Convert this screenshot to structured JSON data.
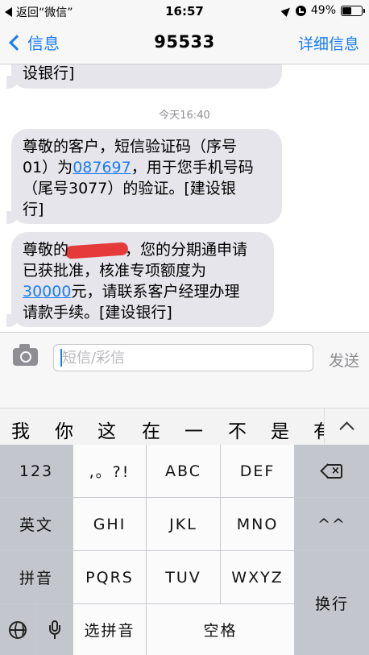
{
  "status_bar": {
    "back_app": "返回“微信”",
    "time": "16:57",
    "battery": "49%",
    "battery_level": 0.49
  },
  "nav": {
    "back_label": "信息",
    "title": "95533",
    "detail_label": "详细信息"
  },
  "messages": {
    "prev_tail": "设银行]",
    "time_separator": "今天16:40",
    "msg1": {
      "line1": "尊敬的客户，短信验证码（序号",
      "line2_prefix": "01）为",
      "code": "087697",
      "line2_suffix": "，用于您手机号码",
      "line3": "（尾号3077）的验证。[建设银",
      "line4": "行]"
    },
    "msg2": {
      "line1_prefix": "尊敬的",
      "line1_suffix": "，您的分期通申请",
      "line2": "已获批准，核准专项额度为",
      "amount": "30000",
      "line3_suffix": "元，请联系客户经理办理",
      "line4": "请款手续。[建设银行]"
    }
  },
  "input": {
    "placeholder": "短信/彩信",
    "send_label": "发送",
    "camera_icon": "camera-icon"
  },
  "candidates": [
    "我",
    "你",
    "这",
    "在",
    "一",
    "不",
    "是",
    "有"
  ],
  "keyboard": {
    "row1": [
      "123",
      ",。?!",
      "ABC",
      "DEF"
    ],
    "row2": [
      "英文",
      "GHI",
      "JKL",
      "MNO",
      "^^"
    ],
    "row3": [
      "拼音",
      "PQRS",
      "TUV",
      "WXYZ"
    ],
    "enter": "换行",
    "select_pinyin": "选拼音",
    "space": "空格"
  },
  "colors": {
    "accent": "#1a7cf5",
    "bubble": "#e6e5eb",
    "redaction": "#e43a3a"
  }
}
